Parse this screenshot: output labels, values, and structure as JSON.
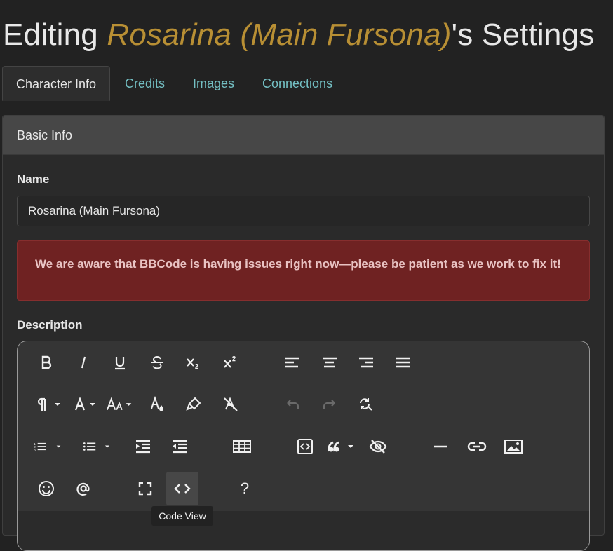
{
  "page": {
    "title_prefix": "Editing ",
    "character_name": "Rosarina (Main Fursona)",
    "title_suffix": "'s Settings"
  },
  "tabs": [
    {
      "label": "Character Info",
      "active": true
    },
    {
      "label": "Credits",
      "active": false
    },
    {
      "label": "Images",
      "active": false
    },
    {
      "label": "Connections",
      "active": false
    }
  ],
  "card": {
    "header": "Basic Info"
  },
  "name_field": {
    "label": "Name",
    "value": "Rosarina (Main Fursona)"
  },
  "alert": {
    "text": "We are aware that BBCode is having issues right now—please be patient as we work to fix it!"
  },
  "description": {
    "label": "Description"
  },
  "editor": {
    "tooltip": "Code View",
    "help_label": "?",
    "toolbar_icons": [
      "bold-icon",
      "italic-icon",
      "underline-icon",
      "strikethrough-icon",
      "subscript-icon",
      "superscript-icon",
      "align-left-icon",
      "align-center-icon",
      "align-right-icon",
      "align-justify-icon",
      "paragraph-format-icon",
      "font-family-icon",
      "font-size-icon",
      "text-color-icon",
      "highlight-icon",
      "clear-format-icon",
      "undo-icon",
      "redo-icon",
      "find-replace-icon",
      "ordered-list-icon",
      "unordered-list-icon",
      "indent-icon",
      "outdent-icon",
      "table-icon",
      "embed-icon",
      "quote-icon",
      "spoiler-icon",
      "horizontal-rule-icon",
      "link-icon",
      "image-icon",
      "emoji-icon",
      "mention-icon",
      "fullscreen-icon",
      "code-view-icon",
      "help-icon"
    ]
  },
  "colors": {
    "background": "#222222",
    "accent_name": "#b88f34",
    "tab_link": "#74c0c4",
    "alert_bg": "#6f2222",
    "alert_text": "#e9c3c3"
  }
}
